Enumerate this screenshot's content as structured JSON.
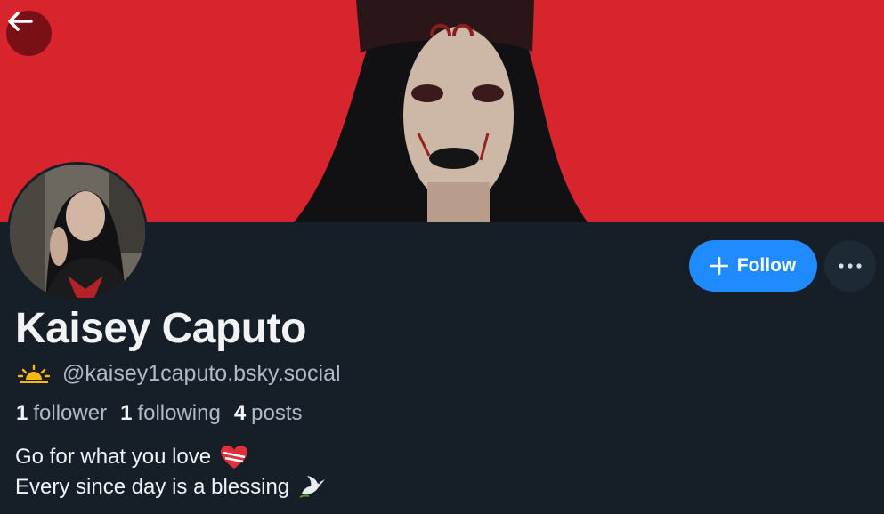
{
  "profile": {
    "display_name": "Kaisey Caputo",
    "handle": "@kaisey1caputo.bsky.social",
    "stats": {
      "followers_count": "1",
      "followers_label": "follower",
      "following_count": "1",
      "following_label": "following",
      "posts_count": "4",
      "posts_label": "posts"
    },
    "bio": [
      {
        "text": "Go for what you love",
        "icon": "heart-icon"
      },
      {
        "text": "Every since day is a blessing",
        "icon": "dove-icon"
      }
    ]
  },
  "actions": {
    "follow_label": "Follow"
  },
  "icons": {
    "back": "arrow-left-icon",
    "follow": "plus-icon",
    "more": "ellipsis-icon",
    "handle_badge": "sunrise-icon"
  },
  "colors": {
    "banner": "#d8252d",
    "background": "#161e27",
    "accent": "#208bfe",
    "muted_text": "#aebbc9"
  }
}
